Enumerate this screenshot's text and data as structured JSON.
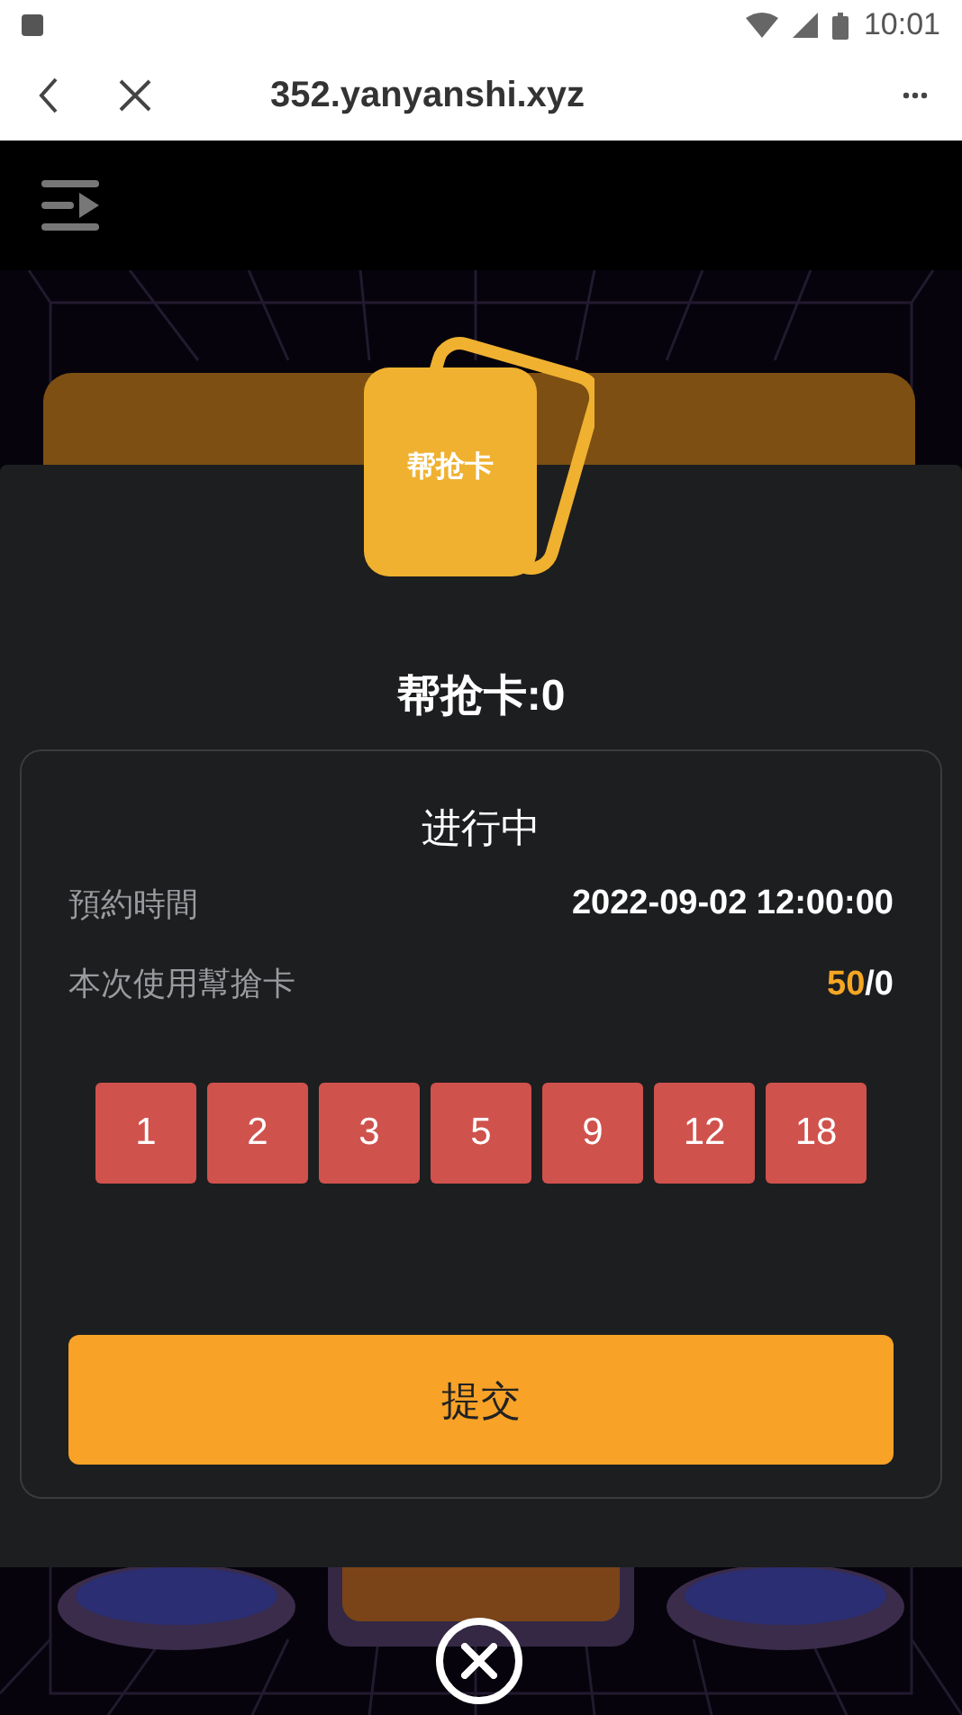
{
  "status_bar": {
    "time": "10:01"
  },
  "browser": {
    "title": "352.yanyanshi.xyz"
  },
  "sheet": {
    "card_label": "帮抢卡",
    "title": "帮抢卡:0",
    "status": "进行中",
    "rows": [
      {
        "label": "預約時間",
        "value": "2022-09-02 12:00:00"
      },
      {
        "label": "本次使用幫搶卡",
        "highlight": "50",
        "value": "/0"
      }
    ],
    "numbers": [
      "1",
      "2",
      "3",
      "5",
      "9",
      "12",
      "18"
    ],
    "submit": "提交"
  }
}
